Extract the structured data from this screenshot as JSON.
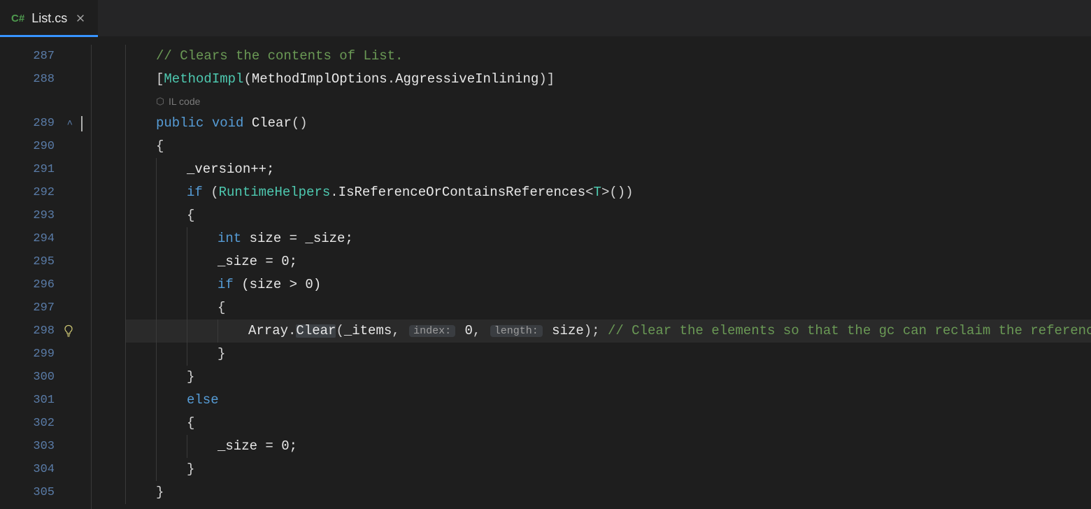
{
  "tab": {
    "language_badge": "C#",
    "filename": "List.cs"
  },
  "codelens_label": "IL code",
  "lines": {
    "287": {
      "comment": "// Clears the contents of List."
    },
    "288": {
      "attr_open": "[",
      "attr_type": "MethodImpl",
      "attr_lp": "(",
      "attr_enum_type": "MethodImplOptions",
      "attr_dot": ".",
      "attr_enum_member": "AggressiveInlining",
      "attr_rp": ")",
      "attr_close": "]"
    },
    "289": {
      "kw_public": "public",
      "kw_void": "void",
      "method_name": "Clear",
      "parens": "()"
    },
    "290": {
      "brace": "{"
    },
    "291": {
      "stmt": "_version++;"
    },
    "292": {
      "kw_if": "if",
      "lp": " (",
      "helper_type": "RuntimeHelpers",
      "dot1": ".",
      "helper_method": "IsReferenceOrContainsReferences",
      "lt": "<",
      "generic_T": "T",
      "gt": ">",
      "call_close": "())"
    },
    "293": {
      "brace": "{"
    },
    "294": {
      "kw_int": "int",
      "rest": " size = _size;"
    },
    "295": {
      "stmt": "_size = 0;"
    },
    "296": {
      "kw_if": "if",
      "cond": " (size > 0)"
    },
    "297": {
      "brace": "{"
    },
    "298": {
      "arr_type": "Array",
      "dot": ".",
      "clear_call": "Clear",
      "lp": "(",
      "arg1": "_items",
      "comma1": ", ",
      "hint_index": "index:",
      "zero": " 0",
      "comma2": ", ",
      "hint_length": "length:",
      "size_arg": " size",
      "rp": ");",
      "trailing_comment": " // Clear the elements so that the gc can reclaim the references."
    },
    "299": {
      "brace": "}"
    },
    "300": {
      "brace": "}"
    },
    "301": {
      "kw_else": "else"
    },
    "302": {
      "brace": "{"
    },
    "303": {
      "stmt": "_size = 0;"
    },
    "304": {
      "brace": "}"
    },
    "305": {
      "brace": "}"
    }
  },
  "line_numbers": [
    "287",
    "288",
    "289",
    "290",
    "291",
    "292",
    "293",
    "294",
    "295",
    "296",
    "297",
    "298",
    "299",
    "300",
    "301",
    "302",
    "303",
    "304",
    "305"
  ]
}
